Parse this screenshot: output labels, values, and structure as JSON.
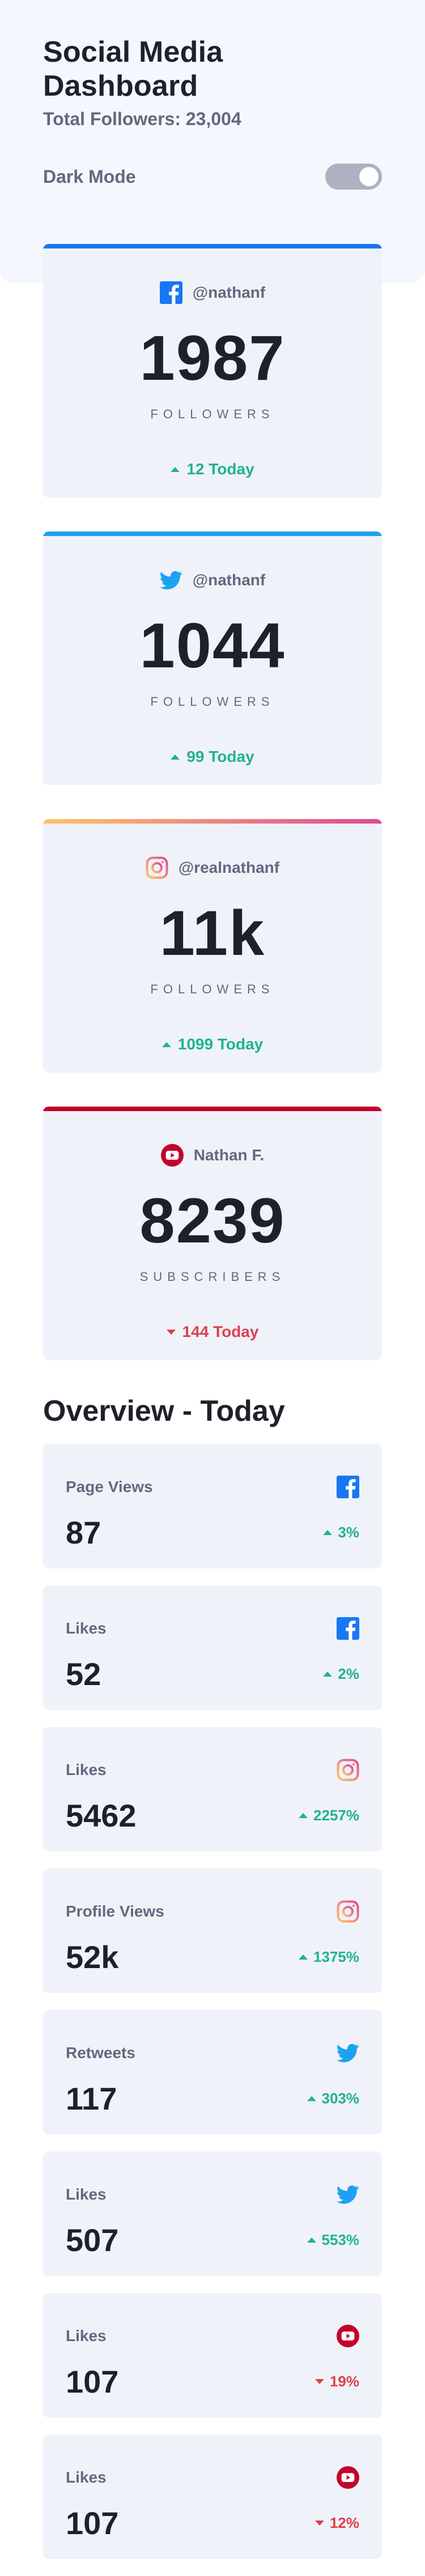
{
  "header": {
    "title": "Social Media Dashboard",
    "total_followers": "Total Followers: 23,004"
  },
  "mode": {
    "label": "Dark Mode",
    "enabled": false
  },
  "colors": {
    "facebook": "#1877f2",
    "twitter": "#1da1f2",
    "instagram_start": "#fdc468",
    "instagram_end": "#df4996",
    "youtube": "#c4032b",
    "positive": "#1eb589",
    "negative": "#dc414c"
  },
  "cards": [
    {
      "network": "facebook",
      "icon": "facebook-icon",
      "handle": "@nathanf",
      "count": "1987",
      "unit": "FOLLOWERS",
      "delta": "12 Today",
      "direction": "up"
    },
    {
      "network": "twitter",
      "icon": "twitter-icon",
      "handle": "@nathanf",
      "count": "1044",
      "unit": "FOLLOWERS",
      "delta": "99 Today",
      "direction": "up"
    },
    {
      "network": "instagram",
      "icon": "instagram-icon",
      "handle": "@realnathanf",
      "count": "11k",
      "unit": "FOLLOWERS",
      "delta": "1099 Today",
      "direction": "up"
    },
    {
      "network": "youtube",
      "icon": "youtube-icon",
      "handle": "Nathan F.",
      "count": "8239",
      "unit": "SUBSCRIBERS",
      "delta": "144 Today",
      "direction": "down"
    }
  ],
  "overview": {
    "title": "Overview - Today",
    "items": [
      {
        "metric": "Page Views",
        "network": "facebook",
        "icon": "facebook-icon",
        "value": "87",
        "pct": "3%",
        "direction": "up"
      },
      {
        "metric": "Likes",
        "network": "facebook",
        "icon": "facebook-icon",
        "value": "52",
        "pct": "2%",
        "direction": "up"
      },
      {
        "metric": "Likes",
        "network": "instagram",
        "icon": "instagram-icon",
        "value": "5462",
        "pct": "2257%",
        "direction": "up"
      },
      {
        "metric": "Profile Views",
        "network": "instagram",
        "icon": "instagram-icon",
        "value": "52k",
        "pct": "1375%",
        "direction": "up"
      },
      {
        "metric": "Retweets",
        "network": "twitter",
        "icon": "twitter-icon",
        "value": "117",
        "pct": "303%",
        "direction": "up"
      },
      {
        "metric": "Likes",
        "network": "twitter",
        "icon": "twitter-icon",
        "value": "507",
        "pct": "553%",
        "direction": "up"
      },
      {
        "metric": "Likes",
        "network": "youtube",
        "icon": "youtube-icon",
        "value": "107",
        "pct": "19%",
        "direction": "down"
      },
      {
        "metric": "Likes",
        "network": "youtube",
        "icon": "youtube-icon",
        "value": "107",
        "pct": "12%",
        "direction": "down"
      }
    ]
  }
}
